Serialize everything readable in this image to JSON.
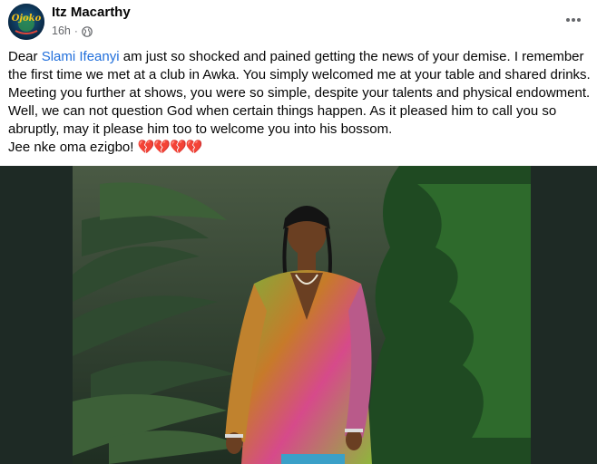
{
  "post": {
    "author": "Itz Macarthy",
    "avatar_text": "Ojoko",
    "timestamp": "16h",
    "separator": "·",
    "audience_icon": "globe-icon",
    "more_icon": "more-options-icon",
    "text": {
      "lead": "Dear ",
      "mention": "Slami Ifeanyi",
      "body": " am just so shocked and pained getting the news of your demise. I remember the first time we met at a club in Awka. You simply welcomed me at your table and shared drinks. Meeting you further at shows, you were so simple, despite your talents and physical endowment. Well, we can not question God when certain things happen. As it pleased him to call you so abruptly, may it please him too to welcome you into his bossom.",
      "closing": "Jee nke oma ezigbo! ",
      "hearts": "💔💔💔💔"
    }
  },
  "colors": {
    "mention": "#216fdb",
    "secondary_text": "#65676b",
    "photo_bg": "#1e2a25"
  }
}
